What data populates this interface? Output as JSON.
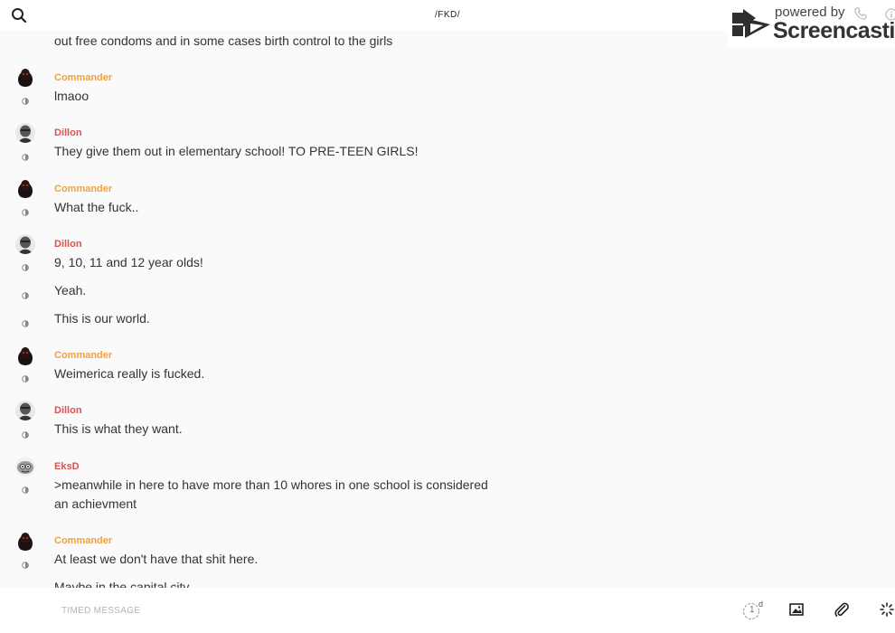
{
  "header": {
    "title": "/FKD/",
    "search_icon": "search-icon"
  },
  "watermark": {
    "small": "powered by",
    "big": "Screencastify"
  },
  "colors": {
    "commander": "#f0a040",
    "dillon": "#d9534f",
    "eksd": "#d9534f"
  },
  "messages": [
    {
      "text": "out free condoms and in some cases birth control to the girls"
    },
    {
      "author": "Commander",
      "text": "lmaoo"
    },
    {
      "author": "Dillon",
      "text": "They give them out in elementary school! TO PRE-TEEN GIRLS!"
    },
    {
      "author": "Commander",
      "text": "What the fuck.."
    },
    {
      "author": "Dillon",
      "text": "9, 10, 11 and 12 year olds!"
    },
    {
      "text": "Yeah."
    },
    {
      "text": "This is our world."
    },
    {
      "author": "Commander",
      "text": "Weimerica really is fucked."
    },
    {
      "author": "Dillon",
      "text": "This is what they want."
    },
    {
      "author": "EksD",
      "text_line1": ">meanwhile in here to have more than 10 whores in one school is considered",
      "text_line2": "an achievment"
    },
    {
      "author": "Commander",
      "text": "At least we don't have that shit here."
    },
    {
      "text": "Maybe in the capital city."
    }
  ],
  "composer": {
    "placeholder": "TIMED MESSAGE",
    "timer_value": "1",
    "timer_unit": "d"
  }
}
